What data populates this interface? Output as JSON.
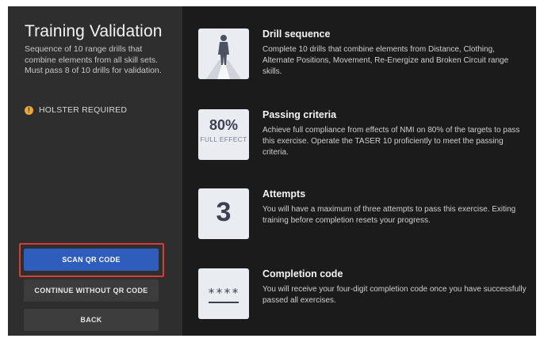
{
  "sidebar": {
    "title": "Training Validation",
    "description": "Sequence of 10 range drills that combine elements from all skill sets. Must pass 8 of 10 drills for validation.",
    "notice": "HOLSTER REQUIRED",
    "notice_icon": "warning-icon",
    "buttons": {
      "scan": "SCAN QR CODE",
      "continue": "CONTINUE WITHOUT QR CODE",
      "back": "BACK"
    }
  },
  "sections": [
    {
      "icon": "person-silhouette-icon",
      "title": "Drill sequence",
      "text": "Complete 10 drills that combine elements from Distance, Clothing, Alternate Positions, Movement, Re-Energize and Broken Circuit range skills."
    },
    {
      "icon_big": "80%",
      "icon_small": "FULL EFFECT",
      "title": "Passing criteria",
      "text": "Achieve full compliance from effects of NMI on 80% of the targets to pass this exercise. Operate the TASER 10 proficiently to meet the passing criteria."
    },
    {
      "icon_big": "3",
      "title": "Attempts",
      "text": "You will have a maximum of three attempts to pass this exercise. Exiting training before completion resets your progress."
    },
    {
      "icon_big": "****",
      "title": "Completion code",
      "text": "You will receive your four-digit completion code once you have successfully passed all exercises."
    }
  ],
  "colors": {
    "primary_button": "#2f5dbc",
    "highlight": "#d93a3a",
    "warning": "#f0a92a"
  }
}
